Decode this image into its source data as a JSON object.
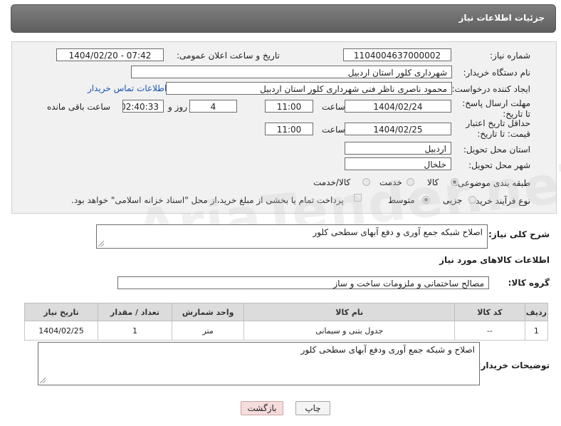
{
  "header": {
    "title": "جزئیات اطلاعات نیاز"
  },
  "form": {
    "need_number_label": "شماره نیاز:",
    "need_number": "1104004637000002",
    "announce_label": "تاریخ و ساعت اعلان عمومی:",
    "announce_value": "1404/02/20 - 07:42",
    "buyer_org_label": "نام دستگاه خریدار:",
    "buyer_org": "شهرداری کلور استان اردبیل",
    "creator_label": "ایجاد کننده درخواست:",
    "creator": "محمود  ناصری  ناظر فنی  شهرداری کلور استان اردبیل",
    "buyer_contact_link": "اطلاعات تماس خریدار",
    "deadline_label": "مهلت ارسال پاسخ: تا تاریخ:",
    "deadline_date": "1404/02/24",
    "time_label": "ساعت",
    "deadline_time": "11:00",
    "days_value": "4",
    "days_label": "روز و",
    "remaining_time": "02:40:33",
    "remaining_label": "ساعت باقی مانده",
    "validity_label": "حداقل تاریخ اعتبار قیمت: تا تاریخ:",
    "validity_date": "1404/02/25",
    "validity_time": "11:00",
    "province_label": "استان محل تحویل:",
    "province": "اردبیل",
    "city_label": "شهر محل تحویل:",
    "city": "خلخال",
    "category_label": "طبقه بندی موضوعی:",
    "category_options": [
      "کالا",
      "خدمت",
      "کالا/خدمت"
    ],
    "process_label": "نوع فرآیند خرید :",
    "process_options": [
      "جزیی",
      "متوسط"
    ],
    "payment_note": "پرداخت تمام یا بخشی از مبلغ خرید،از محل \"اسناد خزانه اسلامی\" خواهد بود."
  },
  "description": {
    "label": "شرح کلی نیاز:",
    "value": "اصلاح شبکه جمع آوری و دفع آبهای سطحی کلور"
  },
  "goods": {
    "section_title": "اطلاعات کالاهای مورد نیاز",
    "group_label": "گروه کالا:",
    "group_value": "مصالح ساختمانی و ملزومات ساخت و ساز",
    "columns": [
      "ردیف",
      "کد کالا",
      "نام کالا",
      "واحد شمارش",
      "تعداد / مقدار",
      "تاریخ نیاز"
    ],
    "rows": [
      [
        "1",
        "--",
        "جدول بتنی و سیمانی",
        "متر",
        "1",
        "1404/02/25"
      ]
    ]
  },
  "buyer_notes": {
    "label": "توضیحات خریدار:",
    "value": "اصلاح و شبکه جمع آوری ودفع آبهای سطحی کلور"
  },
  "buttons": {
    "print": "چاپ",
    "back": "بازگشت"
  },
  "watermark": "AriaTender.neT"
}
